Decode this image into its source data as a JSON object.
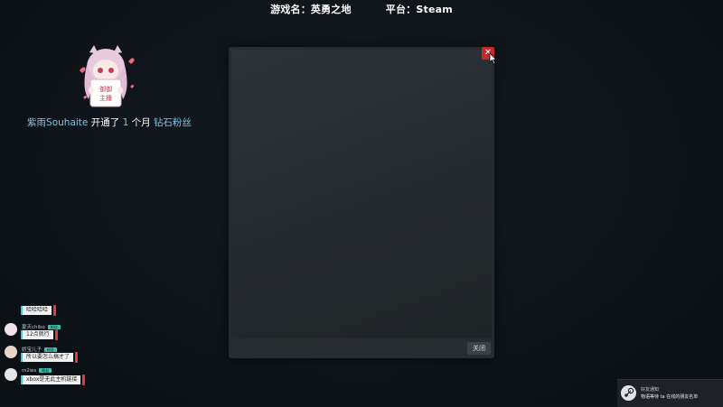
{
  "header": {
    "game_label": "游戏名：英勇之地",
    "platform_label": "平台：Steam"
  },
  "subscription": {
    "user": "紫雨Souhaite",
    "action": " 开通了 ",
    "count": "1",
    "unit": " 个月 ",
    "tier": "钻石粉丝"
  },
  "mascot": {
    "sign_text": "御御主播"
  },
  "modal": {
    "close_label": "✕",
    "footer_button": "关闭"
  },
  "chat": {
    "items": [
      {
        "user": "",
        "badge": "",
        "message": "哈哈哈哈"
      },
      {
        "user": "夏天chibo",
        "badge": "粉丝",
        "message": "12点就行"
      },
      {
        "user": "娇宝儿子",
        "badge": "粉丝",
        "message": "所以要怎么搞才了"
      },
      {
        "user": "m2ws",
        "badge": "粉丝",
        "message": "xbox是无此主机链接"
      }
    ]
  },
  "toast": {
    "title": "好友通知",
    "text": "物语等待 ta 在线的朋友名单"
  },
  "colors": {
    "background": "#0f1519",
    "accent": "#7fc4e6",
    "close_red": "#c42a2a",
    "badge_teal": "#3fbfae"
  },
  "icons": {
    "close": "close-icon",
    "cursor": "mouse-cursor-icon",
    "steam": "steam-icon"
  }
}
